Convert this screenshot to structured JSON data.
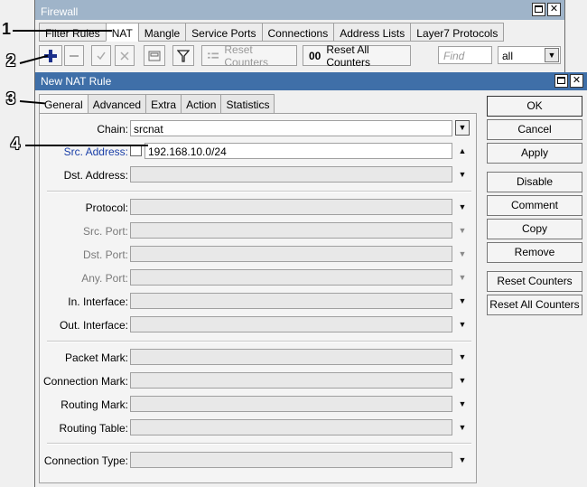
{
  "firewall": {
    "title": "Firewall",
    "tabs": [
      "Filter Rules",
      "NAT",
      "Mangle",
      "Service Ports",
      "Connections",
      "Address Lists",
      "Layer7 Protocols"
    ],
    "toolbar": {
      "reset_counters": "Reset Counters",
      "reset_all_counters": "Reset All Counters",
      "reset_all_prefix": "00",
      "find_placeholder": "Find",
      "filter_value": "all"
    }
  },
  "nat_window": {
    "title": "New NAT Rule",
    "tabs": [
      "General",
      "Advanced",
      "Extra",
      "Action",
      "Statistics"
    ],
    "fields": {
      "chain": {
        "label": "Chain:",
        "value": "srcnat"
      },
      "src_address": {
        "label": "Src. Address:",
        "value": "192.168.10.0/24"
      },
      "dst_address": {
        "label": "Dst. Address:"
      },
      "protocol": {
        "label": "Protocol:"
      },
      "src_port": {
        "label": "Src. Port:"
      },
      "dst_port": {
        "label": "Dst. Port:"
      },
      "any_port": {
        "label": "Any. Port:"
      },
      "in_interface": {
        "label": "In. Interface:"
      },
      "out_interface": {
        "label": "Out. Interface:"
      },
      "packet_mark": {
        "label": "Packet Mark:"
      },
      "connection_mark": {
        "label": "Connection Mark:"
      },
      "routing_mark": {
        "label": "Routing Mark:"
      },
      "routing_table": {
        "label": "Routing Table:"
      },
      "connection_type": {
        "label": "Connection Type:"
      }
    },
    "buttons": {
      "ok": "OK",
      "cancel": "Cancel",
      "apply": "Apply",
      "disable": "Disable",
      "comment": "Comment",
      "copy": "Copy",
      "remove": "Remove",
      "reset_counters": "Reset Counters",
      "reset_all_counters": "Reset All Counters"
    }
  },
  "annotations": [
    "1",
    "2",
    "3",
    "4"
  ],
  "colors": {
    "nat_titlebar": "#3f6fa8",
    "firewall_titlebar": "#9fb4c9",
    "add_icon": "#1a2f8a",
    "src_label": "#1a3fa8"
  }
}
